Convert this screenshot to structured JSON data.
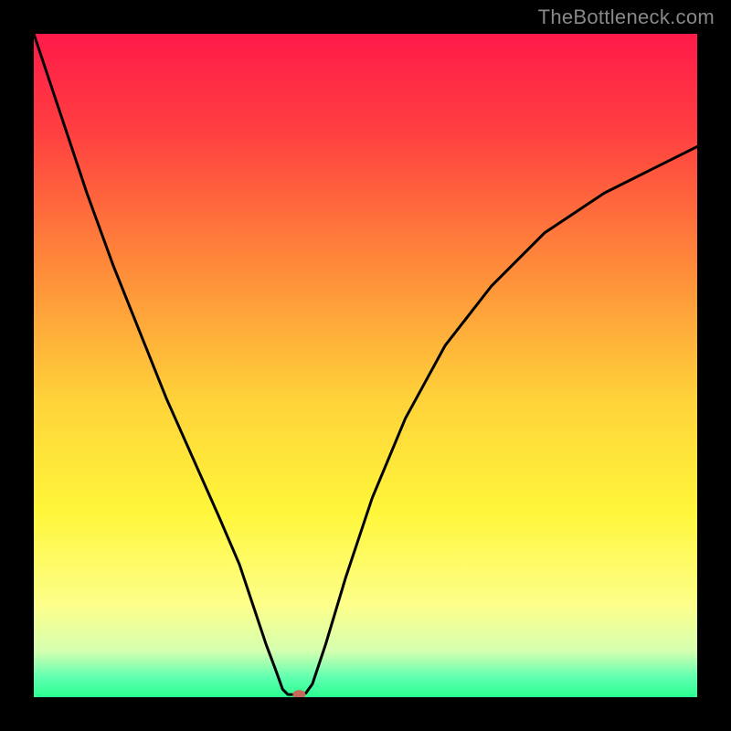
{
  "watermark": "TheBottleneck.com",
  "chart_data": {
    "type": "line",
    "title": "",
    "xlabel": "",
    "ylabel": "",
    "xlim": [
      0,
      100
    ],
    "ylim": [
      0,
      100
    ],
    "background": {
      "type": "vertical-gradient",
      "stops": [
        {
          "pos": 0.0,
          "color": "#ff1a4a"
        },
        {
          "pos": 0.15,
          "color": "#ff4040"
        },
        {
          "pos": 0.35,
          "color": "#ff8a3a"
        },
        {
          "pos": 0.55,
          "color": "#ffd23a"
        },
        {
          "pos": 0.72,
          "color": "#fff63a"
        },
        {
          "pos": 0.86,
          "color": "#fdff8a"
        },
        {
          "pos": 0.93,
          "color": "#d6ffb0"
        },
        {
          "pos": 0.97,
          "color": "#60ffb0"
        },
        {
          "pos": 1.0,
          "color": "#2aff90"
        }
      ]
    },
    "series": [
      {
        "name": "bottleneck-curve",
        "color": "#000000",
        "stroke_width": 3,
        "points": [
          {
            "x": 0,
            "y": 100
          },
          {
            "x": 2,
            "y": 94
          },
          {
            "x": 5,
            "y": 85
          },
          {
            "x": 8,
            "y": 76
          },
          {
            "x": 12,
            "y": 65
          },
          {
            "x": 16,
            "y": 55
          },
          {
            "x": 20,
            "y": 45
          },
          {
            "x": 24,
            "y": 36
          },
          {
            "x": 28,
            "y": 27
          },
          {
            "x": 31,
            "y": 20
          },
          {
            "x": 33,
            "y": 14
          },
          {
            "x": 35,
            "y": 8
          },
          {
            "x": 36.5,
            "y": 4
          },
          {
            "x": 37.5,
            "y": 1.2
          },
          {
            "x": 38.3,
            "y": 0.4
          },
          {
            "x": 40,
            "y": 0.4
          },
          {
            "x": 41,
            "y": 0.6
          },
          {
            "x": 42,
            "y": 2
          },
          {
            "x": 44,
            "y": 8
          },
          {
            "x": 47,
            "y": 18
          },
          {
            "x": 51,
            "y": 30
          },
          {
            "x": 56,
            "y": 42
          },
          {
            "x": 62,
            "y": 53
          },
          {
            "x": 69,
            "y": 62
          },
          {
            "x": 77,
            "y": 70
          },
          {
            "x": 86,
            "y": 76
          },
          {
            "x": 94,
            "y": 80
          },
          {
            "x": 100,
            "y": 83
          }
        ]
      }
    ],
    "marker": {
      "x": 40,
      "y": 0.4,
      "rx": 7,
      "ry": 5,
      "color": "#c46a5a"
    }
  }
}
